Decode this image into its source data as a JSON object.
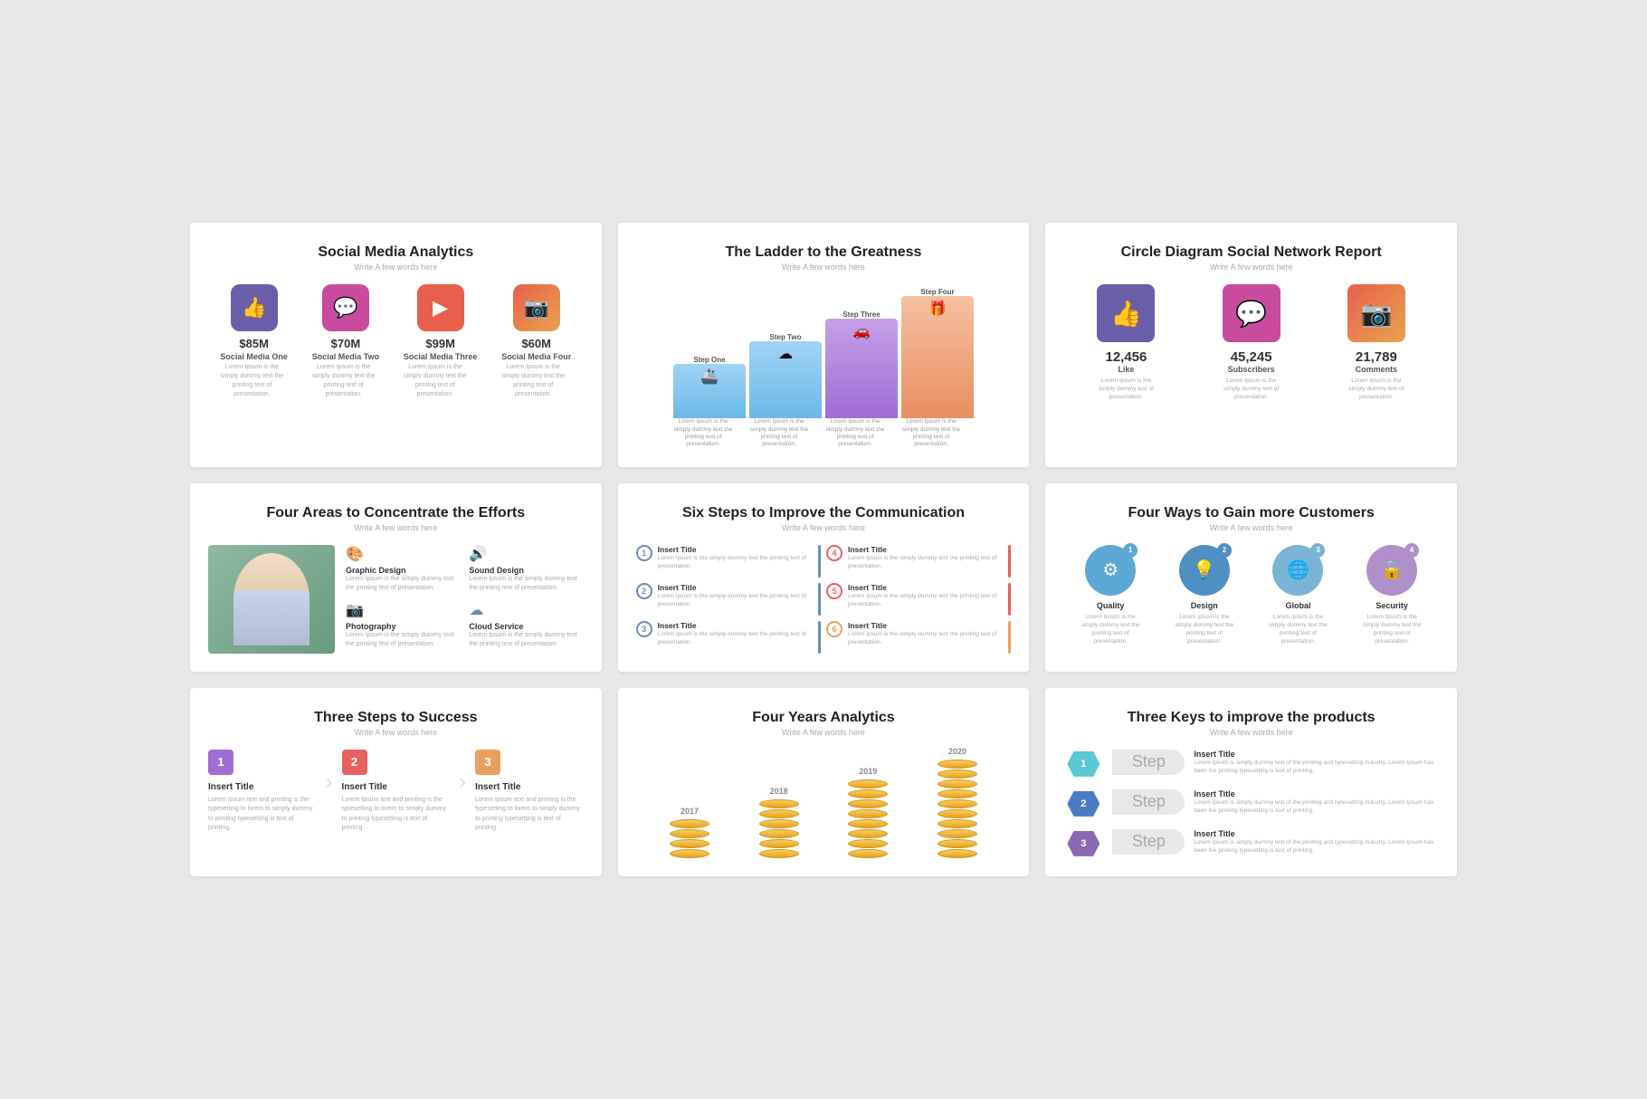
{
  "slides": [
    {
      "id": "slide1",
      "title": "Social Media Analytics",
      "subtitle": "Write A few words here",
      "items": [
        {
          "icon": "👍",
          "type": "fb",
          "amount": "$85M",
          "name": "Social Media One",
          "desc": "Lorem Ipsum is the simply dummy text the printing text of presentation."
        },
        {
          "icon": "💬",
          "type": "wa",
          "amount": "$70M",
          "name": "Social Media Two",
          "desc": "Lorem Ipsum is the simply dummy text the printing text of presentation."
        },
        {
          "icon": "▶",
          "type": "yt",
          "amount": "$99M",
          "name": "Social Media Three",
          "desc": "Lorem Ipsum is the simply dummy text the printing text of presentation."
        },
        {
          "icon": "📷",
          "type": "ig",
          "amount": "$60M",
          "name": "Social Media Four",
          "desc": "Lorem Ipsum is the simply dummy text the printing text of presentation."
        }
      ]
    },
    {
      "id": "slide2",
      "title": "The Ladder to the Greatness",
      "subtitle": "Write A few words here",
      "steps": [
        {
          "label": "Step One",
          "desc": "Lorem Ipsum is the simply dummy text the printing text of presentation."
        },
        {
          "label": "Step Two",
          "desc": "Lorem Ipsum is the simply dummy text the printing text of presentation."
        },
        {
          "label": "Step Three",
          "desc": "Lorem Ipsum is the simply dummy text the printing text of presentation."
        },
        {
          "label": "Step Four",
          "desc": "Lorem Ipsum is the simply dummy text the printing text of presentation."
        }
      ]
    },
    {
      "id": "slide3",
      "title": "Circle Diagram Social Network Report",
      "subtitle": "Write A few words here",
      "items": [
        {
          "type": "fb",
          "icon": "👍",
          "num": "12,456",
          "label": "Like",
          "desc": "Lorem Ipsum is the simply dummy text of presentation."
        },
        {
          "type": "wa",
          "icon": "💬",
          "num": "45,245",
          "label": "Subscribers",
          "desc": "Lorem Ipsum is the simply dummy text of presentation."
        },
        {
          "type": "ig",
          "icon": "📷",
          "num": "21,789",
          "label": "Comments",
          "desc": "Lorem Ipsum is the simply dummy text of presentation."
        }
      ]
    },
    {
      "id": "slide4",
      "title": "Four Areas to Concentrate the Efforts",
      "subtitle": "Write A few words here",
      "services": [
        {
          "icon": "🎨",
          "title": "Graphic Design",
          "desc": "Lorem Ipsum is the simply dummy text the printing text of presentation."
        },
        {
          "icon": "🔊",
          "title": "Sound Design",
          "desc": "Lorem Ipsum is the simply dummy text the printing text of presentation."
        },
        {
          "icon": "📷",
          "title": "Photography",
          "desc": "Lorem Ipsum is the simply dummy text the printing text of presentation."
        },
        {
          "icon": "☁",
          "title": "Cloud Service",
          "desc": "Lorem Ipsum is the simply dummy text the printing text of presentation."
        }
      ]
    },
    {
      "id": "slide5",
      "title": "Six Steps to Improve the Communication",
      "subtitle": "Write A few words here",
      "steps": [
        {
          "num": "1",
          "color": "blue",
          "title": "Insert Title",
          "desc": "Lorem Ipsum is the simply dummy text the printing text of presentation."
        },
        {
          "num": "4",
          "color": "red",
          "title": "Insert Title",
          "desc": "Lorem Ipsum is the simply dummy text the printing text of presentation."
        },
        {
          "num": "2",
          "color": "blue",
          "title": "Insert Title",
          "desc": "Lorem Ipsum is the simply dummy text the printing text of presentation."
        },
        {
          "num": "5",
          "color": "red",
          "title": "Insert Title",
          "desc": "Lorem Ipsum is the simply dummy text the printing text of presentation."
        },
        {
          "num": "3",
          "color": "blue",
          "title": "Insert Title",
          "desc": "Lorem Ipsum is the simply dummy text the printing text of presentation."
        },
        {
          "num": "6",
          "color": "orange",
          "title": "Insert Title",
          "desc": "Lorem Ipsum is the simply dummy text the printing text of presentation."
        }
      ]
    },
    {
      "id": "slide6",
      "title": "Four Ways to Gain more Customers",
      "subtitle": "Write A few words here",
      "items": [
        {
          "num": "1",
          "color": "c1",
          "icon": "⚙",
          "label": "Quality",
          "desc": "Lorem Ipsum is the simply dummy text the printing text of presentation."
        },
        {
          "num": "2",
          "color": "c2",
          "icon": "💡",
          "label": "Design",
          "desc": "Lorem Ipsum is the simply dummy text the printing text of presentation."
        },
        {
          "num": "3",
          "color": "c3",
          "icon": "🌐",
          "label": "Global",
          "desc": "Lorem Ipsum is the simply dummy text the printing text of presentation."
        },
        {
          "num": "4",
          "color": "c4",
          "icon": "🔒",
          "label": "Security",
          "desc": "Lorem Ipsum is the simply dummy text the printing text of presentation."
        }
      ]
    },
    {
      "id": "slide7",
      "title": "Three Steps to Success",
      "subtitle": "Write A few words here",
      "steps": [
        {
          "num": "1",
          "color": "ts-n1",
          "title": "Insert Title",
          "desc": "Lorem Ipsum text and printing is the typesetting to lorem to simply dummy to printing typesetting is text of printing."
        },
        {
          "num": "2",
          "color": "ts-n2",
          "title": "Insert Title",
          "desc": "Lorem Ipsum text and printing is the typesetting to lorem to simply dummy to printing typesetting is text of printing."
        },
        {
          "num": "3",
          "color": "ts-n3",
          "title": "Insert Title",
          "desc": "Lorem Ipsum text and printing is the typesetting to lorem to simply dummy to printing typesetting is text of printing."
        }
      ]
    },
    {
      "id": "slide8",
      "title": "Four Years Analytics",
      "subtitle": "Write A few words here",
      "years": [
        {
          "year": "2017",
          "coins": 4
        },
        {
          "year": "2018",
          "coins": 6
        },
        {
          "year": "2019",
          "coins": 8
        },
        {
          "year": "2020",
          "coins": 10
        }
      ]
    },
    {
      "id": "slide9",
      "title": "Three Keys to improve the products",
      "subtitle": "Write A few words here",
      "steps": [
        {
          "num": "1",
          "color": "tk-d1",
          "step": "Step",
          "title": "Insert Title",
          "desc": "Lorem Ipsum is simply dummy text of the printing and typesetting industry. Lorem Ipsum has been the printing typesetting is text of printing."
        },
        {
          "num": "2",
          "color": "tk-d2",
          "step": "Step",
          "title": "Insert Title",
          "desc": "Lorem Ipsum is simply dummy text of the printing and typesetting industry. Lorem Ipsum has been the printing typesetting is text of printing."
        },
        {
          "num": "3",
          "color": "tk-d3",
          "step": "Step",
          "title": "Insert Title",
          "desc": "Lorem Ipsum is simply dummy text of the printing and typesetting industry. Lorem Ipsum has been the printing typesetting is text of printing."
        }
      ]
    }
  ]
}
